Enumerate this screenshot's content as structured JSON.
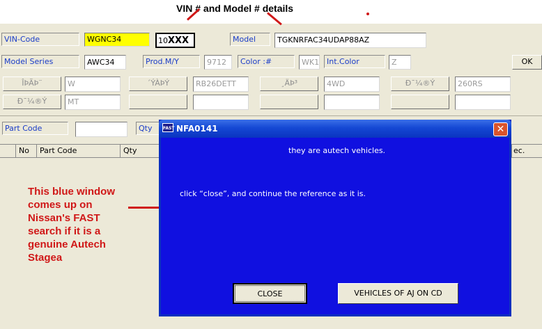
{
  "annotations": {
    "header_note": "VIN # and Model # details",
    "side_note": "This blue window comes up on Nissan's FAST search if it is a genuine Autech Stagea"
  },
  "form": {
    "vin_code_label": "VIN-Code",
    "vin_code_value": "WGNC34",
    "vin_serial_prefix": "10",
    "vin_serial_value": "XXX",
    "model_label": "Model",
    "model_value": "TGKNRFAC34UDAP88AZ",
    "model_series_label": "Model Series",
    "model_series_value": "AWC34",
    "prod_my_label": "Prod.M/Y",
    "prod_my_value": "9712",
    "color_label": "Color :#",
    "color_value": "WK1",
    "int_color_label": "Int.Color",
    "int_color_value": "Z",
    "ok_label": "OK",
    "attr_row1": [
      {
        "button": "ÎÞÃÞ¨",
        "value": "W"
      },
      {
        "button": "´ÝÀÞÝ",
        "value": "RB26DETT"
      },
      {
        "button": "¸ÄÞ³",
        "value": "4WD"
      },
      {
        "button": "Ð¯¼®Ý",
        "value": "260RS"
      }
    ],
    "attr_row2": [
      {
        "button": "Ð¯¼®Ý",
        "value": "MT"
      },
      {
        "button": "",
        "value": ""
      },
      {
        "button": "",
        "value": ""
      },
      {
        "button": "",
        "value": ""
      }
    ],
    "part_code_label": "Part Code",
    "part_code_value": "",
    "qty_label": "Qty"
  },
  "table": {
    "columns": [
      "No",
      "Part Code",
      "Qty"
    ],
    "last_column_fragment": "ec."
  },
  "dialog": {
    "title": "NFA0141",
    "icon_text": "FAST",
    "close_glyph": "✕",
    "message1": "they are autech vehicles.",
    "message2": "click “close”, and continue the reference as it is.",
    "close_button": "CLOSE",
    "vehicles_button": "VEHICLES OF AJ ON CD"
  },
  "colors": {
    "dialog_bg": "#1010e0",
    "annotation_red": "#d01818",
    "vin_highlight": "#ffff00"
  }
}
